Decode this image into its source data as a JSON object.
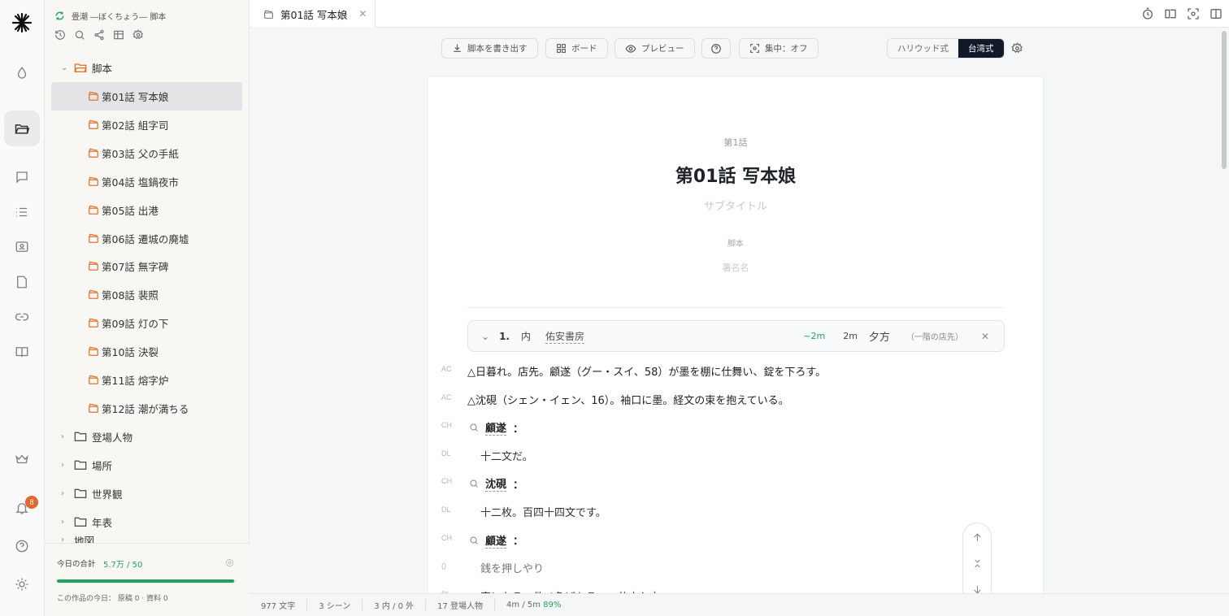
{
  "project": {
    "title": "畳潮 ―ぼくちょう― 脚本"
  },
  "tree": {
    "script_folder": "脚本",
    "episodes": [
      "第01話 写本娘",
      "第02話 組字司",
      "第03話 父の手紙",
      "第04話 塩鍋夜市",
      "第05話 出港",
      "第06話 遷城の廃墟",
      "第07話 無字碑",
      "第08話 裴照",
      "第09話 灯の下",
      "第10話 決裂",
      "第11話 熔字炉",
      "第12話 潮が満ちる"
    ],
    "folders": [
      "登場人物",
      "場所",
      "世界観",
      "年表",
      "地図"
    ]
  },
  "footer": {
    "today_label": "今日の合計",
    "today_value": "5.7万 / 50",
    "today_progress": 0.99,
    "work_today": "この作品の今日： 原稿 0 · 資料 0"
  },
  "notifications": {
    "count": "8"
  },
  "tab": {
    "title": "第01話 写本娘"
  },
  "toolbar": {
    "export": "脚本を書き出す",
    "board": "ボード",
    "preview": "プレビュー",
    "focus": "集中：オフ",
    "style_hollywood": "ハリウッド式",
    "style_taiwan": "台湾式"
  },
  "page": {
    "episode_label": "第1話",
    "title": "第01話 写本娘",
    "subtitle_placeholder": "サブタイトル",
    "credit_label": "脚本",
    "author_placeholder": "署名名"
  },
  "scene": {
    "number": "1.",
    "int_ext": "内",
    "location": "佑安書房",
    "est": "~2m",
    "dur": "2m",
    "time": "夕方",
    "note": "（一階の店先）"
  },
  "lines": [
    {
      "tag": "AC",
      "text": "△日暮れ。店先。顧遂（グー・スイ、58）が墨を棚に仕舞い、錠を下ろす。"
    },
    {
      "tag": "AC",
      "text": "△沈硯（シェン・イェン、16）。袖口に墨。経文の束を抱えている。"
    },
    {
      "tag": "CH",
      "name": "顧遂"
    },
    {
      "tag": "DL",
      "text": "十二文だ。"
    },
    {
      "tag": "CH",
      "name": "沈硯"
    },
    {
      "tag": "DL",
      "text": "十二枚。百四十四文です。"
    },
    {
      "tag": "CH",
      "name": "顧遂"
    },
    {
      "tag": "()",
      "text": "銭を押しやり"
    },
    {
      "tag": "DL",
      "text": "字になる。件ノ色ばちる……仕十入文"
    }
  ],
  "status": {
    "chars": "977 文字",
    "scenes": "3 シーン",
    "int_ext": "3 内 / 0 外",
    "characters": "17 登場人物",
    "time": "4m / 5m",
    "pct": "89%"
  },
  "colors": {
    "accent": "#e5732a",
    "green": "#22a55a",
    "dark": "#111827"
  }
}
